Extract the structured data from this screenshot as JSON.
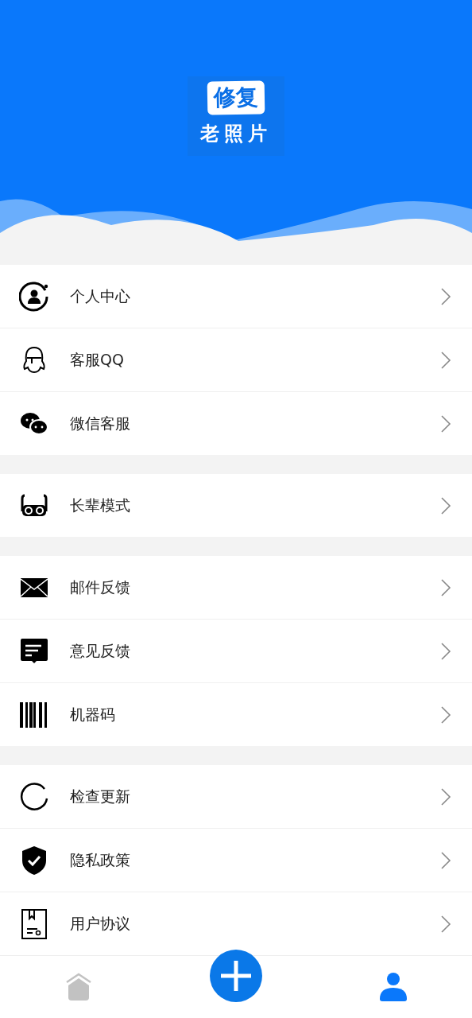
{
  "header": {
    "logo_badge": "修复",
    "logo_text": "老照片"
  },
  "groups": [
    {
      "items": [
        {
          "label": "个人中心"
        },
        {
          "label": "客服QQ"
        },
        {
          "label": "微信客服"
        }
      ]
    },
    {
      "items": [
        {
          "label": "长辈模式"
        }
      ]
    },
    {
      "items": [
        {
          "label": "邮件反馈"
        },
        {
          "label": "意见反馈"
        },
        {
          "label": "机器码"
        }
      ]
    },
    {
      "items": [
        {
          "label": "检查更新"
        },
        {
          "label": "隐私政策"
        },
        {
          "label": "用户协议"
        }
      ]
    }
  ],
  "bottom_nav": [
    {
      "kind": "home",
      "selected": false
    },
    {
      "kind": "add",
      "selected": false
    },
    {
      "kind": "profile",
      "selected": true
    }
  ]
}
